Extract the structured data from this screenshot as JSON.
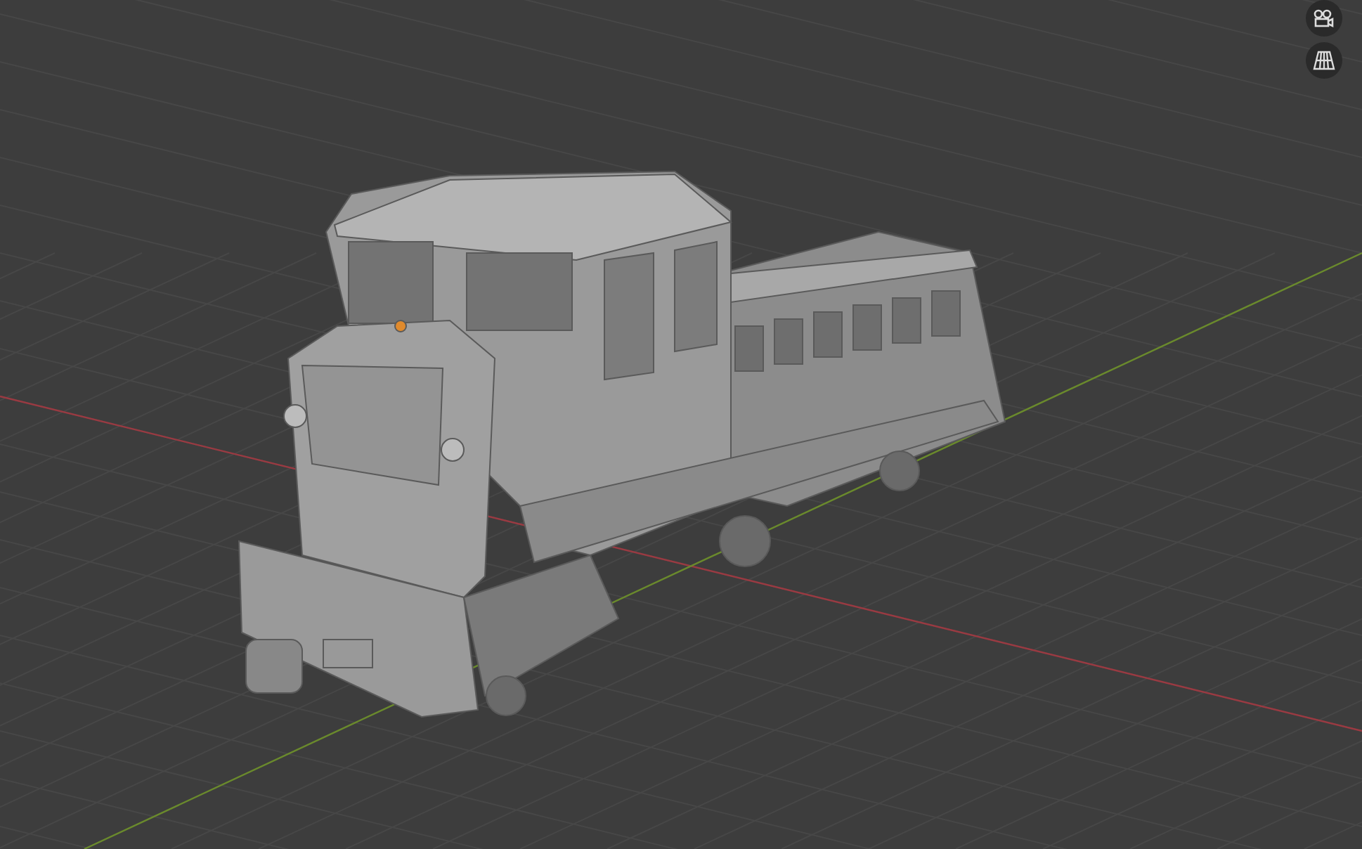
{
  "viewport": {
    "axes": [
      {
        "kind": "x",
        "color": "#9a3a42"
      },
      {
        "kind": "y",
        "color": "#6a8a2c"
      }
    ]
  },
  "gizmos": [
    {
      "kind": "camera"
    },
    {
      "kind": "grid"
    }
  ]
}
